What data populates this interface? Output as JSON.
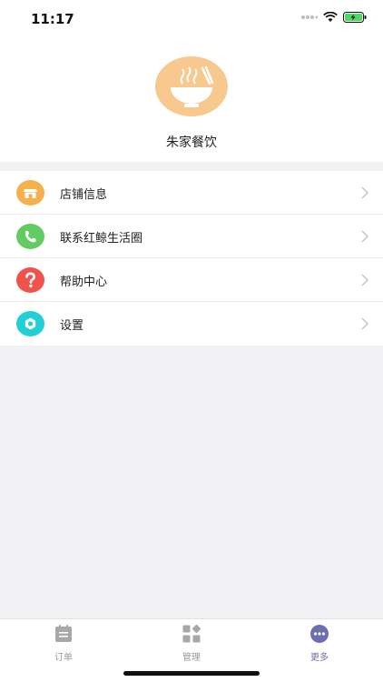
{
  "status_bar": {
    "time": "11:17"
  },
  "store": {
    "name": "朱家餐饮",
    "logo_icon": "noodle-bowl-icon"
  },
  "menu": {
    "items": [
      {
        "label": "店铺信息",
        "icon": "store-info-icon",
        "color": "#f5b14d"
      },
      {
        "label": "联系红鲸生活圈",
        "icon": "phone-icon",
        "color": "#62cc63"
      },
      {
        "label": "帮助中心",
        "icon": "question-icon",
        "color": "#f0524c"
      },
      {
        "label": "设置",
        "icon": "gear-icon",
        "color": "#22cfd6"
      }
    ]
  },
  "tabbar": {
    "tabs": [
      {
        "label": "订单",
        "icon": "order-icon",
        "active": false
      },
      {
        "label": "管理",
        "icon": "manage-icon",
        "active": false
      },
      {
        "label": "更多",
        "icon": "more-icon",
        "active": true
      }
    ]
  },
  "colors": {
    "accent": "#6b6fb1",
    "logo_bg": "#f7c98e",
    "background": "#f2f2f4"
  }
}
